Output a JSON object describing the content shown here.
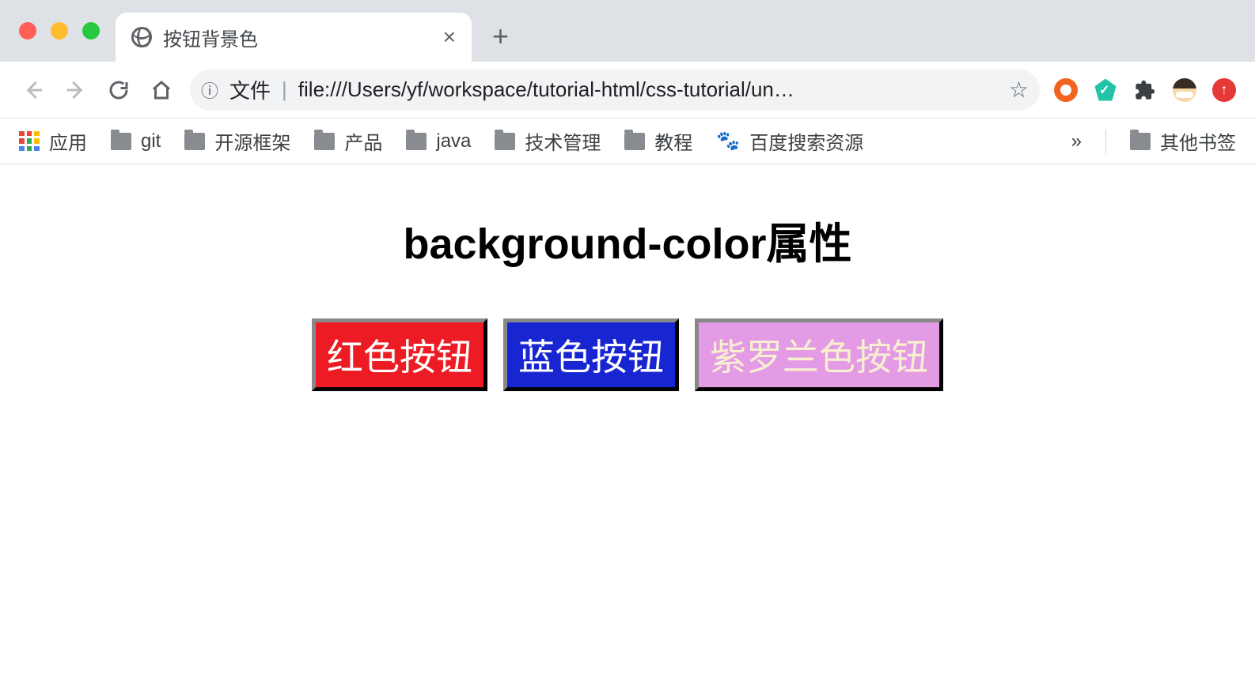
{
  "browser": {
    "tab": {
      "title": "按钮背景色"
    },
    "addressbar": {
      "scheme_label": "文件",
      "url_display": "file:///Users/yf/workspace/tutorial-html/css-tutorial/un…"
    },
    "bookmarks": {
      "apps": "应用",
      "items": [
        {
          "label": "git"
        },
        {
          "label": "开源框架"
        },
        {
          "label": "产品"
        },
        {
          "label": "java"
        },
        {
          "label": "技术管理"
        },
        {
          "label": "教程"
        }
      ],
      "baidu": "百度搜索资源",
      "overflow": "»",
      "other": "其他书签"
    }
  },
  "page": {
    "heading": "background-color属性",
    "buttons": [
      {
        "label": "红色按钮",
        "bg": "#ed1c24",
        "fg": "#ffffff"
      },
      {
        "label": "蓝色按钮",
        "bg": "#1826d2",
        "fg": "#ffffff"
      },
      {
        "label": "紫罗兰色按钮",
        "bg": "#e39be6",
        "fg": "#f7efcf"
      }
    ]
  }
}
